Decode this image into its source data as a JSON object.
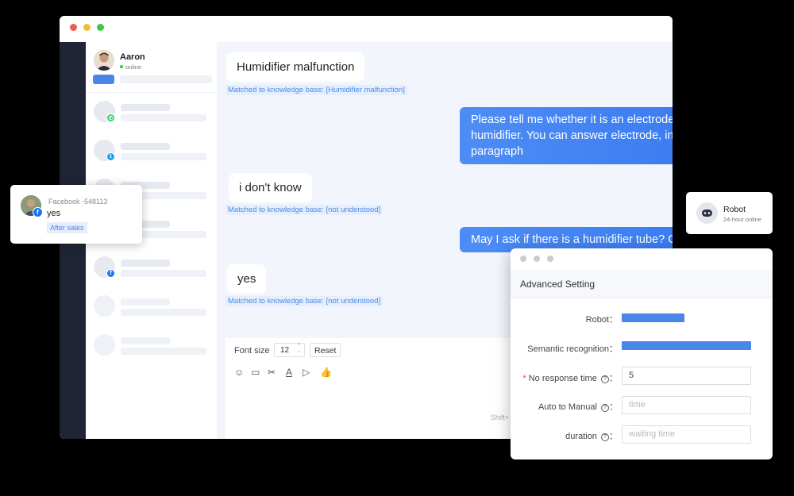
{
  "contact": {
    "name": "Aaron",
    "status": "online"
  },
  "messages": {
    "m1": "Humidifier malfunction",
    "m1_tag": "Matched to knowledge base: [Humidifier malfunction]",
    "m2": "Please tell me whether it is an electrode humidifier or an infrared humidifier. You can answer electrode, infrared or don't know. This paragraph",
    "m3": "i don't know",
    "m3_tag": "Matched to knowledge base: [not understood]",
    "m4": "May I ask if there is a humidifier tube? Can you answer yes or no",
    "m5": "yes",
    "m5_tag": "Matched to knowledge base: [not understood]"
  },
  "composer": {
    "font_size_label": "Font size",
    "font_size_value": "12",
    "reset_label": "Reset",
    "send_hint": "Shift+"
  },
  "facebook_card": {
    "source": "Facebook -548113",
    "message": "yes",
    "tag": "After sales"
  },
  "robot_card": {
    "name": "Robot",
    "status": "24-hour online"
  },
  "advanced": {
    "title": "Advanced Setting",
    "robot_label": "Robot：",
    "semantic_label": "Semantic recognition：",
    "required_mark": "*",
    "no_response_label": "No response time",
    "no_response_value": "5",
    "auto_manual_label": "Auto to Manual",
    "auto_manual_placeholder": "time",
    "duration_label": "duration",
    "duration_placeholder": "waiting time",
    "colon": "："
  },
  "colors": {
    "accent": "#2f72ee",
    "whatsapp": "#25d366",
    "twitter": "#1da1f2",
    "facebook": "#1877f2"
  }
}
